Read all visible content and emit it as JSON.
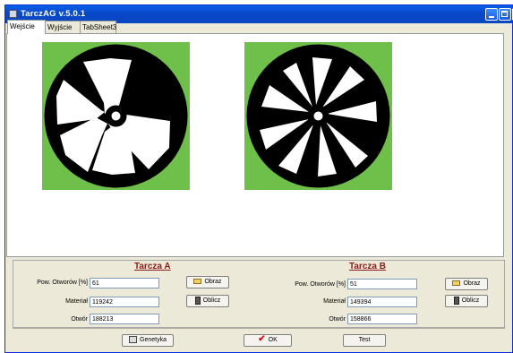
{
  "window": {
    "title": "TarczAG v.5.0.1"
  },
  "tabs": [
    {
      "label": "Wejście",
      "active": true
    },
    {
      "label": "Wyjście",
      "active": false
    },
    {
      "label": "TabSheet3",
      "active": false
    }
  ],
  "colors": {
    "panel_green": "#6fc04a",
    "title_blue": "#0848c8",
    "heading_red": "#8b1a1a"
  },
  "tarcza_a": {
    "heading": "Tarcza A",
    "pow_label": "Pow. Otworów [%]",
    "pow_value": "61",
    "material_label": "Materiał",
    "material_value": "119242",
    "otwor_label": "Otwór",
    "otwor_value": "188213",
    "obraz_label": "Obraz",
    "oblicz_label": "Oblicz"
  },
  "tarcza_b": {
    "heading": "Tarcza B",
    "pow_label": "Pow. Otworów [%]",
    "pow_value": "51",
    "material_label": "Materiał",
    "material_value": "149394",
    "otwor_label": "Otwór",
    "otwor_value": "158866",
    "obraz_label": "Obraz",
    "oblicz_label": "Oblicz"
  },
  "footer": {
    "genetyka_label": "Genetyka",
    "ok_label": "OK",
    "test_label": "Test"
  }
}
